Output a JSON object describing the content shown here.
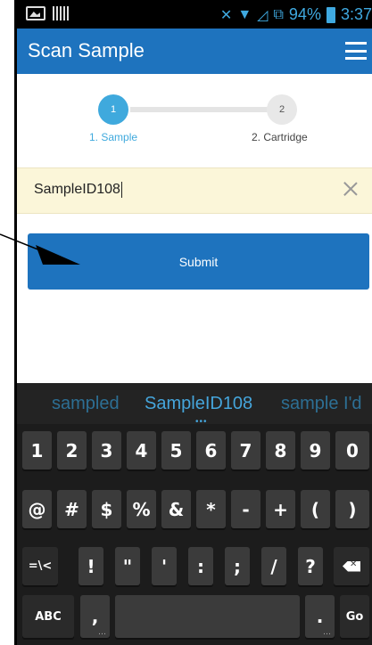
{
  "status_bar": {
    "battery_percent": "94%",
    "time": "3:37"
  },
  "app_bar": {
    "title": "Scan Sample",
    "menu_icon": "hamburger-menu-icon"
  },
  "stepper": {
    "steps": [
      {
        "number": "1",
        "label": "1. Sample",
        "active": true
      },
      {
        "number": "2",
        "label": "2. Cartridge",
        "active": false
      }
    ],
    "active_color": "#3fa9dd"
  },
  "sample_input": {
    "value": "SampleID108",
    "clear_icon": "close-icon"
  },
  "submit_button": {
    "label": "Submit",
    "color": "#1e73be"
  },
  "keyboard": {
    "suggestions": [
      "sampled",
      "SampleID108",
      "sample I'd"
    ],
    "row1": [
      "1",
      "2",
      "3",
      "4",
      "5",
      "6",
      "7",
      "8",
      "9",
      "0"
    ],
    "row2": [
      "@",
      "#",
      "$",
      "%",
      "&",
      "*",
      "-",
      "+",
      "(",
      ")"
    ],
    "row3": [
      "=\\<",
      "!",
      "\"",
      "'",
      ":",
      ";",
      "/",
      "?"
    ],
    "row4": {
      "abc": "ABC",
      "comma": ",",
      "period": ".",
      "go": "Go"
    }
  }
}
